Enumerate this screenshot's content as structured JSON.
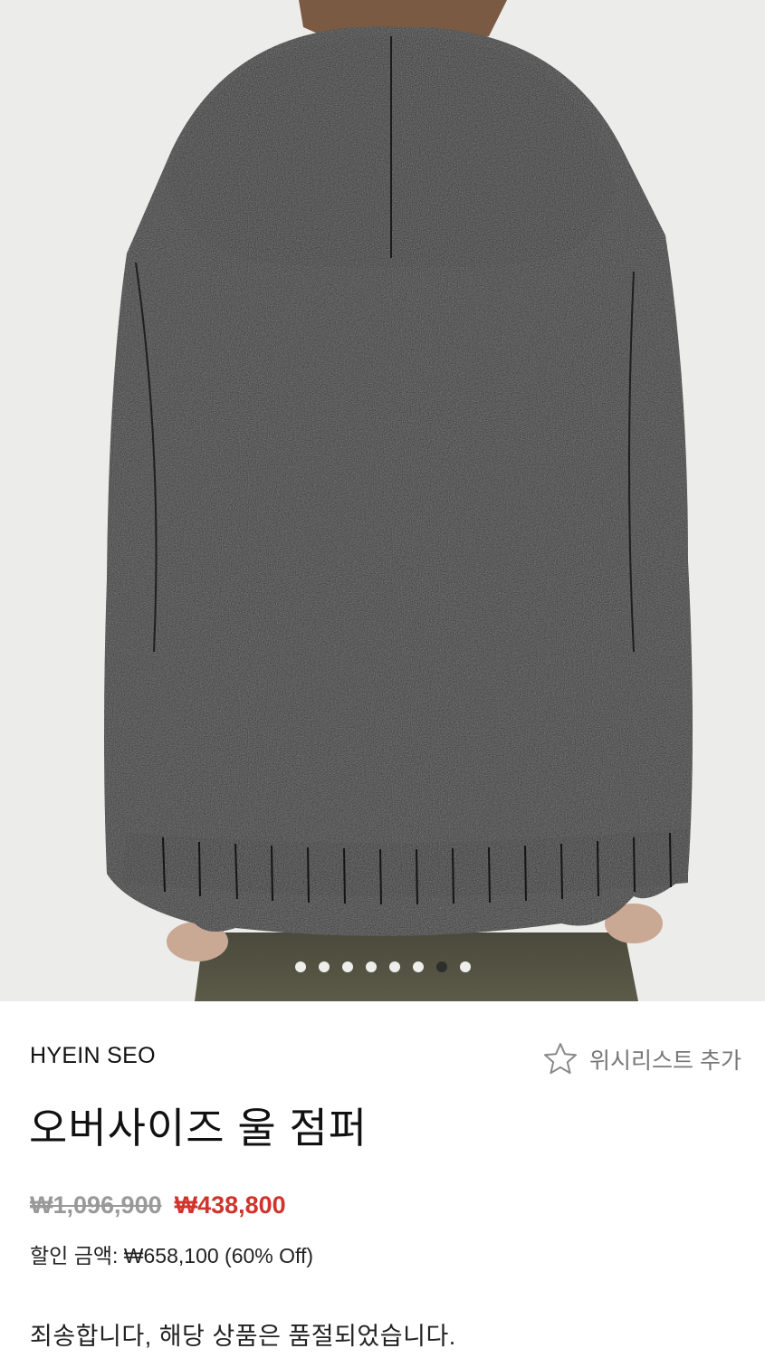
{
  "gallery": {
    "image_alt": "Oversized wool jumper with hood, back view",
    "dot_count": 8,
    "active_dot_index": 6
  },
  "product": {
    "brand": "HYEIN SEO",
    "title": "오버사이즈 울 점퍼",
    "original_price": "₩1,096,900",
    "sale_price": "₩438,800",
    "discount_text": "할인 금액: ₩658,100 (60% Off)",
    "soldout_message": "죄송합니다, 해당 상품은 품절되었습니다."
  },
  "wishlist": {
    "label": "위시리스트 추가",
    "icon": "star-icon"
  },
  "colors": {
    "sale": "#d0342c",
    "muted": "#999999",
    "garment": "#2b2b2b",
    "background": "#ececea"
  }
}
